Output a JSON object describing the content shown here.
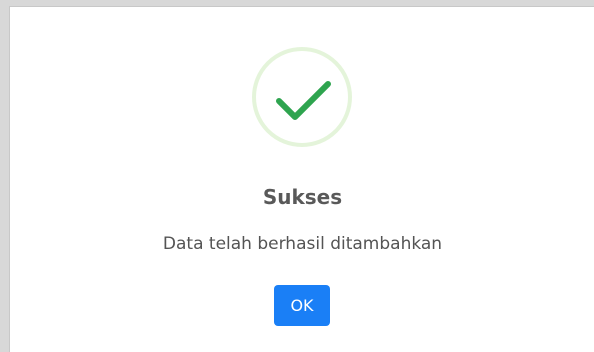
{
  "dialog": {
    "icon": "success-check-icon",
    "title": "Sukses",
    "message": "Data telah berhasil ditambahkan",
    "confirm_label": "OK"
  },
  "colors": {
    "check": "#2ea44f",
    "ring": "#e6f4dc",
    "button": "#1a7ff6",
    "title_text": "#595959"
  }
}
